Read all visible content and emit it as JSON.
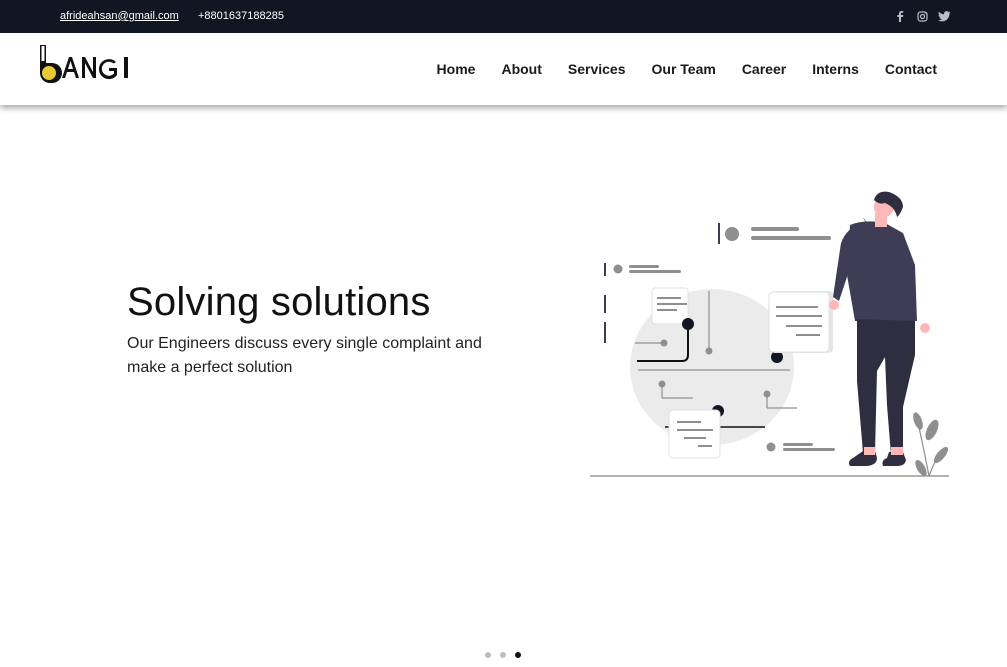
{
  "topbar": {
    "email": "afrideahsan@gmail.com",
    "phone": "+8801637188285",
    "social_icons": [
      "facebook-icon",
      "instagram-icon",
      "twitter-icon"
    ]
  },
  "brand": {
    "logo_text": "BANGI",
    "accent": "#e8c933"
  },
  "nav": {
    "items": [
      "Home",
      "About",
      "Services",
      "Our Team",
      "Career",
      "Interns",
      "Contact"
    ]
  },
  "hero": {
    "title": "Solving solutions",
    "subtitle": "Our Engineers discuss every single complaint and make a perfect solution"
  },
  "carousel": {
    "total_slides": 3,
    "active_slide": 3
  },
  "colors": {
    "topbar_bg": "#111722",
    "text": "#111111",
    "illustration_dark": "#3f3d56",
    "illustration_gray": "#8f8f8f"
  }
}
